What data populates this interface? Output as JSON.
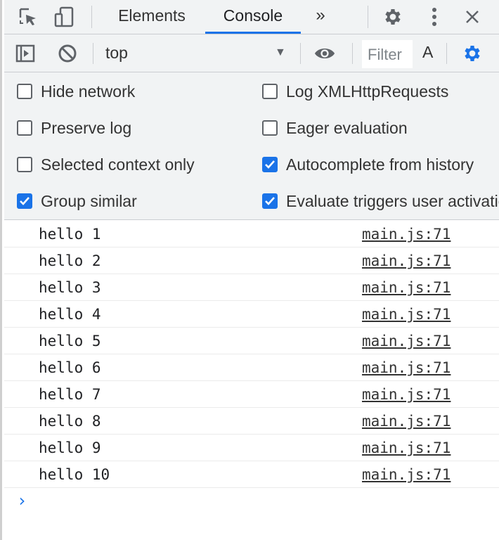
{
  "tabbar": {
    "icons": [
      "inspect-element-icon",
      "device-toggle-icon"
    ],
    "tabs": [
      {
        "label": "Elements",
        "active": false
      },
      {
        "label": "Console",
        "active": true
      }
    ],
    "more_tabs_glyph": "»",
    "right_icons": [
      "settings-gear-icon",
      "kebab-menu-icon",
      "close-icon"
    ],
    "accent_color": "#1a73e8"
  },
  "toolbar": {
    "sidebar_icon": "show-sidebar-icon",
    "clear_icon": "clear-console-icon",
    "context": "top",
    "eye_icon": "live-expression-eye-icon",
    "filter_placeholder": "Filter",
    "font_label": "A",
    "settings_icon": "console-settings-gear-icon"
  },
  "settings": {
    "left": [
      {
        "label": "Hide network",
        "checked": false
      },
      {
        "label": "Preserve log",
        "checked": false
      },
      {
        "label": "Selected context only",
        "checked": false
      },
      {
        "label": "Group similar",
        "checked": true
      }
    ],
    "right": [
      {
        "label": "Log XMLHttpRequests",
        "checked": false
      },
      {
        "label": "Eager evaluation",
        "checked": false
      },
      {
        "label": "Autocomplete from history",
        "checked": true
      },
      {
        "label": "Evaluate triggers user activation",
        "checked": true
      }
    ]
  },
  "logs": [
    {
      "message": "hello 1",
      "source": "main.js:71"
    },
    {
      "message": "hello 2",
      "source": "main.js:71"
    },
    {
      "message": "hello 3",
      "source": "main.js:71"
    },
    {
      "message": "hello 4",
      "source": "main.js:71"
    },
    {
      "message": "hello 5",
      "source": "main.js:71"
    },
    {
      "message": "hello 6",
      "source": "main.js:71"
    },
    {
      "message": "hello 7",
      "source": "main.js:71"
    },
    {
      "message": "hello 8",
      "source": "main.js:71"
    },
    {
      "message": "hello 9",
      "source": "main.js:71"
    },
    {
      "message": "hello 10",
      "source": "main.js:71"
    }
  ],
  "prompt": {
    "glyph": "›"
  }
}
